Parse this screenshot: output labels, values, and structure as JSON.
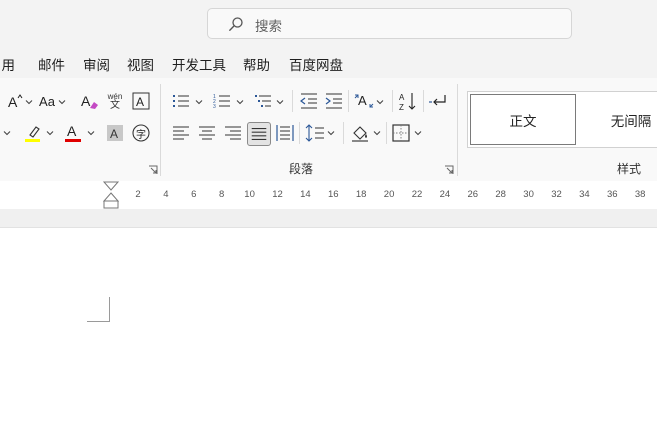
{
  "search": {
    "placeholder": "搜索",
    "icon": "search-icon"
  },
  "menu": {
    "items": [
      "引用",
      "邮件",
      "审阅",
      "视图",
      "开发工具",
      "帮助",
      "百度网盘"
    ]
  },
  "ribbon": {
    "font_group": {
      "buttons": [
        "grow-font-icon",
        "change-case-icon",
        "clear-formatting-icon",
        "phonetic-guide-icon",
        "character-border-icon",
        "highlight-color-icon",
        "font-color-icon",
        "character-shading-icon",
        "enclose-characters-icon"
      ],
      "change_case_label": "Aa",
      "phonetic_top": "wén",
      "phonetic_bottom": "文",
      "enclosed_char": "字",
      "highlight_color": "#ffff00",
      "font_color": "#e00000"
    },
    "paragraph_group": {
      "label": "段落",
      "buttons": [
        "bullets-icon",
        "numbering-icon",
        "multilevel-list-icon",
        "decrease-indent-icon",
        "increase-indent-icon",
        "chinese-layout-icon",
        "sort-icon",
        "show-paragraph-marks-icon",
        "align-left-icon",
        "center-icon",
        "align-right-icon",
        "justify-icon",
        "distributed-icon",
        "line-spacing-icon",
        "shading-icon",
        "borders-icon"
      ]
    },
    "styles_group": {
      "label": "样式",
      "items": [
        "正文",
        "无间隔"
      ]
    }
  },
  "ruler": {
    "ticks": [
      "2",
      "4",
      "6",
      "8",
      "10",
      "12",
      "14",
      "16",
      "18",
      "20",
      "22",
      "24",
      "26",
      "28",
      "30",
      "32",
      "34",
      "36",
      "38"
    ]
  }
}
